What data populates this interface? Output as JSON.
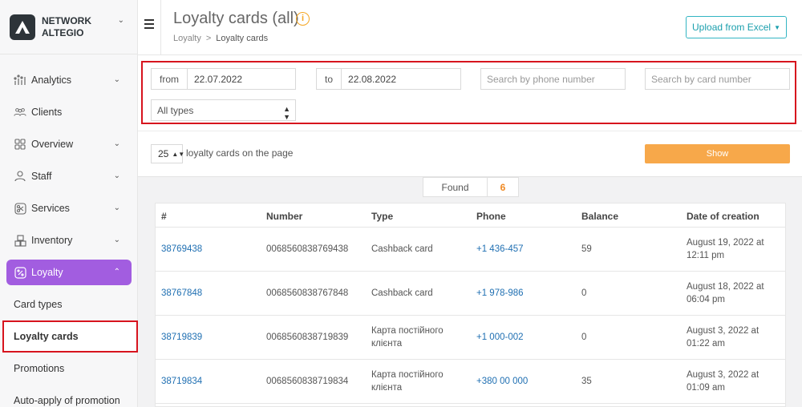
{
  "brand": {
    "line1": "NETWORK",
    "line2": "ALTEGIO"
  },
  "sidebar": {
    "items": [
      {
        "label": "Analytics",
        "icon": "analytics-icon",
        "chevron": true
      },
      {
        "label": "Clients",
        "icon": "clients-icon",
        "chevron": false
      },
      {
        "label": "Overview",
        "icon": "overview-icon",
        "chevron": true
      },
      {
        "label": "Staff",
        "icon": "staff-icon",
        "chevron": true
      },
      {
        "label": "Services",
        "icon": "services-icon",
        "chevron": true
      },
      {
        "label": "Inventory",
        "icon": "inventory-icon",
        "chevron": true
      },
      {
        "label": "Loyalty",
        "icon": "loyalty-icon",
        "chevron": true,
        "active": true
      }
    ],
    "subitems": [
      "Card types",
      "Loyalty cards",
      "Promotions",
      "Auto-apply of promotion"
    ],
    "selected_subitem": "Loyalty cards"
  },
  "header": {
    "title": "Loyalty cards (all)",
    "breadcrumb": [
      "Loyalty",
      "Loyalty cards"
    ],
    "upload_button": "Upload from Excel"
  },
  "filters": {
    "from_label": "from",
    "from_value": "22.07.2022",
    "to_label": "to",
    "to_value": "22.08.2022",
    "phone_placeholder": "Search by phone number",
    "card_placeholder": "Search by card number",
    "type_value": "All types"
  },
  "paging": {
    "per_page": "25",
    "label": "loyalty cards on the page",
    "show_button": "Show"
  },
  "found": {
    "label": "Found",
    "count": "6"
  },
  "table": {
    "columns": [
      "#",
      "Number",
      "Type",
      "Phone",
      "Balance",
      "Date of creation"
    ],
    "rows": [
      {
        "id": "38769438",
        "number": "0068560838769438",
        "type": "Cashback card",
        "phone": "+1 436-457",
        "balance": "59",
        "date": "August 19, 2022 at 12:11 pm"
      },
      {
        "id": "38767848",
        "number": "0068560838767848",
        "type": "Cashback card",
        "phone": "+1 978-986",
        "balance": "0",
        "date": "August 18, 2022 at 06:04 pm"
      },
      {
        "id": "38719839",
        "number": "0068560838719839",
        "type": "Карта постійного клієнта",
        "phone": "+1 000-002",
        "balance": "0",
        "date": "August 3, 2022 at 01:22 am"
      },
      {
        "id": "38719834",
        "number": "0068560838719834",
        "type": "Карта постійного клієнта",
        "phone": "+380 00 000",
        "balance": "35",
        "date": "August 3, 2022 at 01:09 am"
      }
    ]
  },
  "colors": {
    "accent": "#a25de0",
    "show_button": "#f7a84a",
    "highlight": "#d7141e",
    "link": "#1f6fb2",
    "upload_border": "#33b5c3"
  }
}
